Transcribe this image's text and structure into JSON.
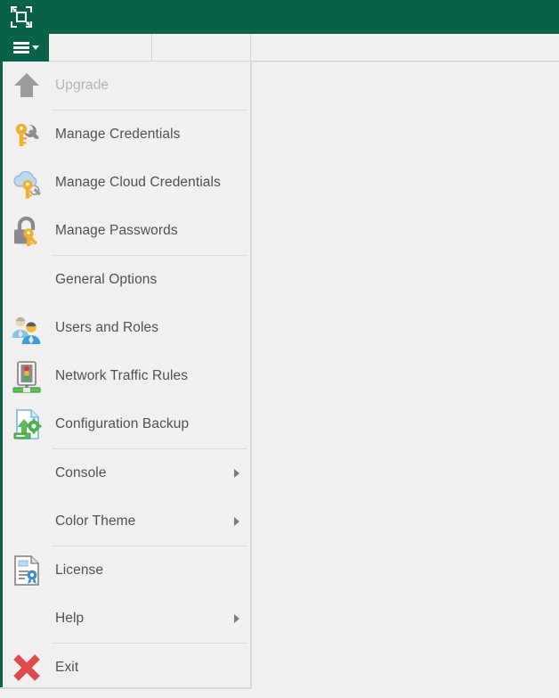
{
  "window": {
    "title_bar": {
      "logo_icon": "veeam-logo-icon",
      "background_color": "#0a6149"
    }
  },
  "ribbon": {
    "menu_tab": {
      "icon": "hamburger-menu-icon",
      "caret_icon": "chevron-down-icon",
      "label": ""
    },
    "background_color": "#f0f0f0"
  },
  "main_menu": {
    "accent_color": "#0a6149",
    "text_color": "#4d5055",
    "disabled_text_color": "#b4b4b4",
    "groups": [
      {
        "items": [
          {
            "id": "upgrade",
            "label": "Upgrade",
            "icon": "upgrade-arrow-icon",
            "disabled": true,
            "has_submenu": false
          }
        ]
      },
      {
        "items": [
          {
            "id": "manage-credentials",
            "label": "Manage Credentials",
            "icon": "key-icon",
            "disabled": false,
            "has_submenu": false
          },
          {
            "id": "manage-cloud-credentials",
            "label": "Manage Cloud Credentials",
            "icon": "cloud-key-icon",
            "disabled": false,
            "has_submenu": false
          },
          {
            "id": "manage-passwords",
            "label": "Manage Passwords",
            "icon": "padlock-key-icon",
            "disabled": false,
            "has_submenu": false
          }
        ]
      },
      {
        "items": [
          {
            "id": "general-options",
            "label": "General Options",
            "icon": "",
            "disabled": false,
            "has_submenu": false
          },
          {
            "id": "users-and-roles",
            "label": "Users and Roles",
            "icon": "users-icon",
            "disabled": false,
            "has_submenu": false
          },
          {
            "id": "network-traffic-rules",
            "label": "Network Traffic Rules",
            "icon": "traffic-light-icon",
            "disabled": false,
            "has_submenu": false
          },
          {
            "id": "configuration-backup",
            "label": "Configuration Backup",
            "icon": "configuration-backup-icon",
            "disabled": false,
            "has_submenu": false
          }
        ]
      },
      {
        "items": [
          {
            "id": "console",
            "label": "Console",
            "icon": "",
            "disabled": false,
            "has_submenu": true
          },
          {
            "id": "color-theme",
            "label": "Color Theme",
            "icon": "",
            "disabled": false,
            "has_submenu": true
          }
        ]
      },
      {
        "items": [
          {
            "id": "license",
            "label": "License",
            "icon": "license-certificate-icon",
            "disabled": false,
            "has_submenu": false
          },
          {
            "id": "help",
            "label": "Help",
            "icon": "",
            "disabled": false,
            "has_submenu": true
          }
        ]
      },
      {
        "items": [
          {
            "id": "exit",
            "label": "Exit",
            "icon": "exit-cross-icon",
            "disabled": false,
            "has_submenu": false
          }
        ]
      }
    ]
  }
}
